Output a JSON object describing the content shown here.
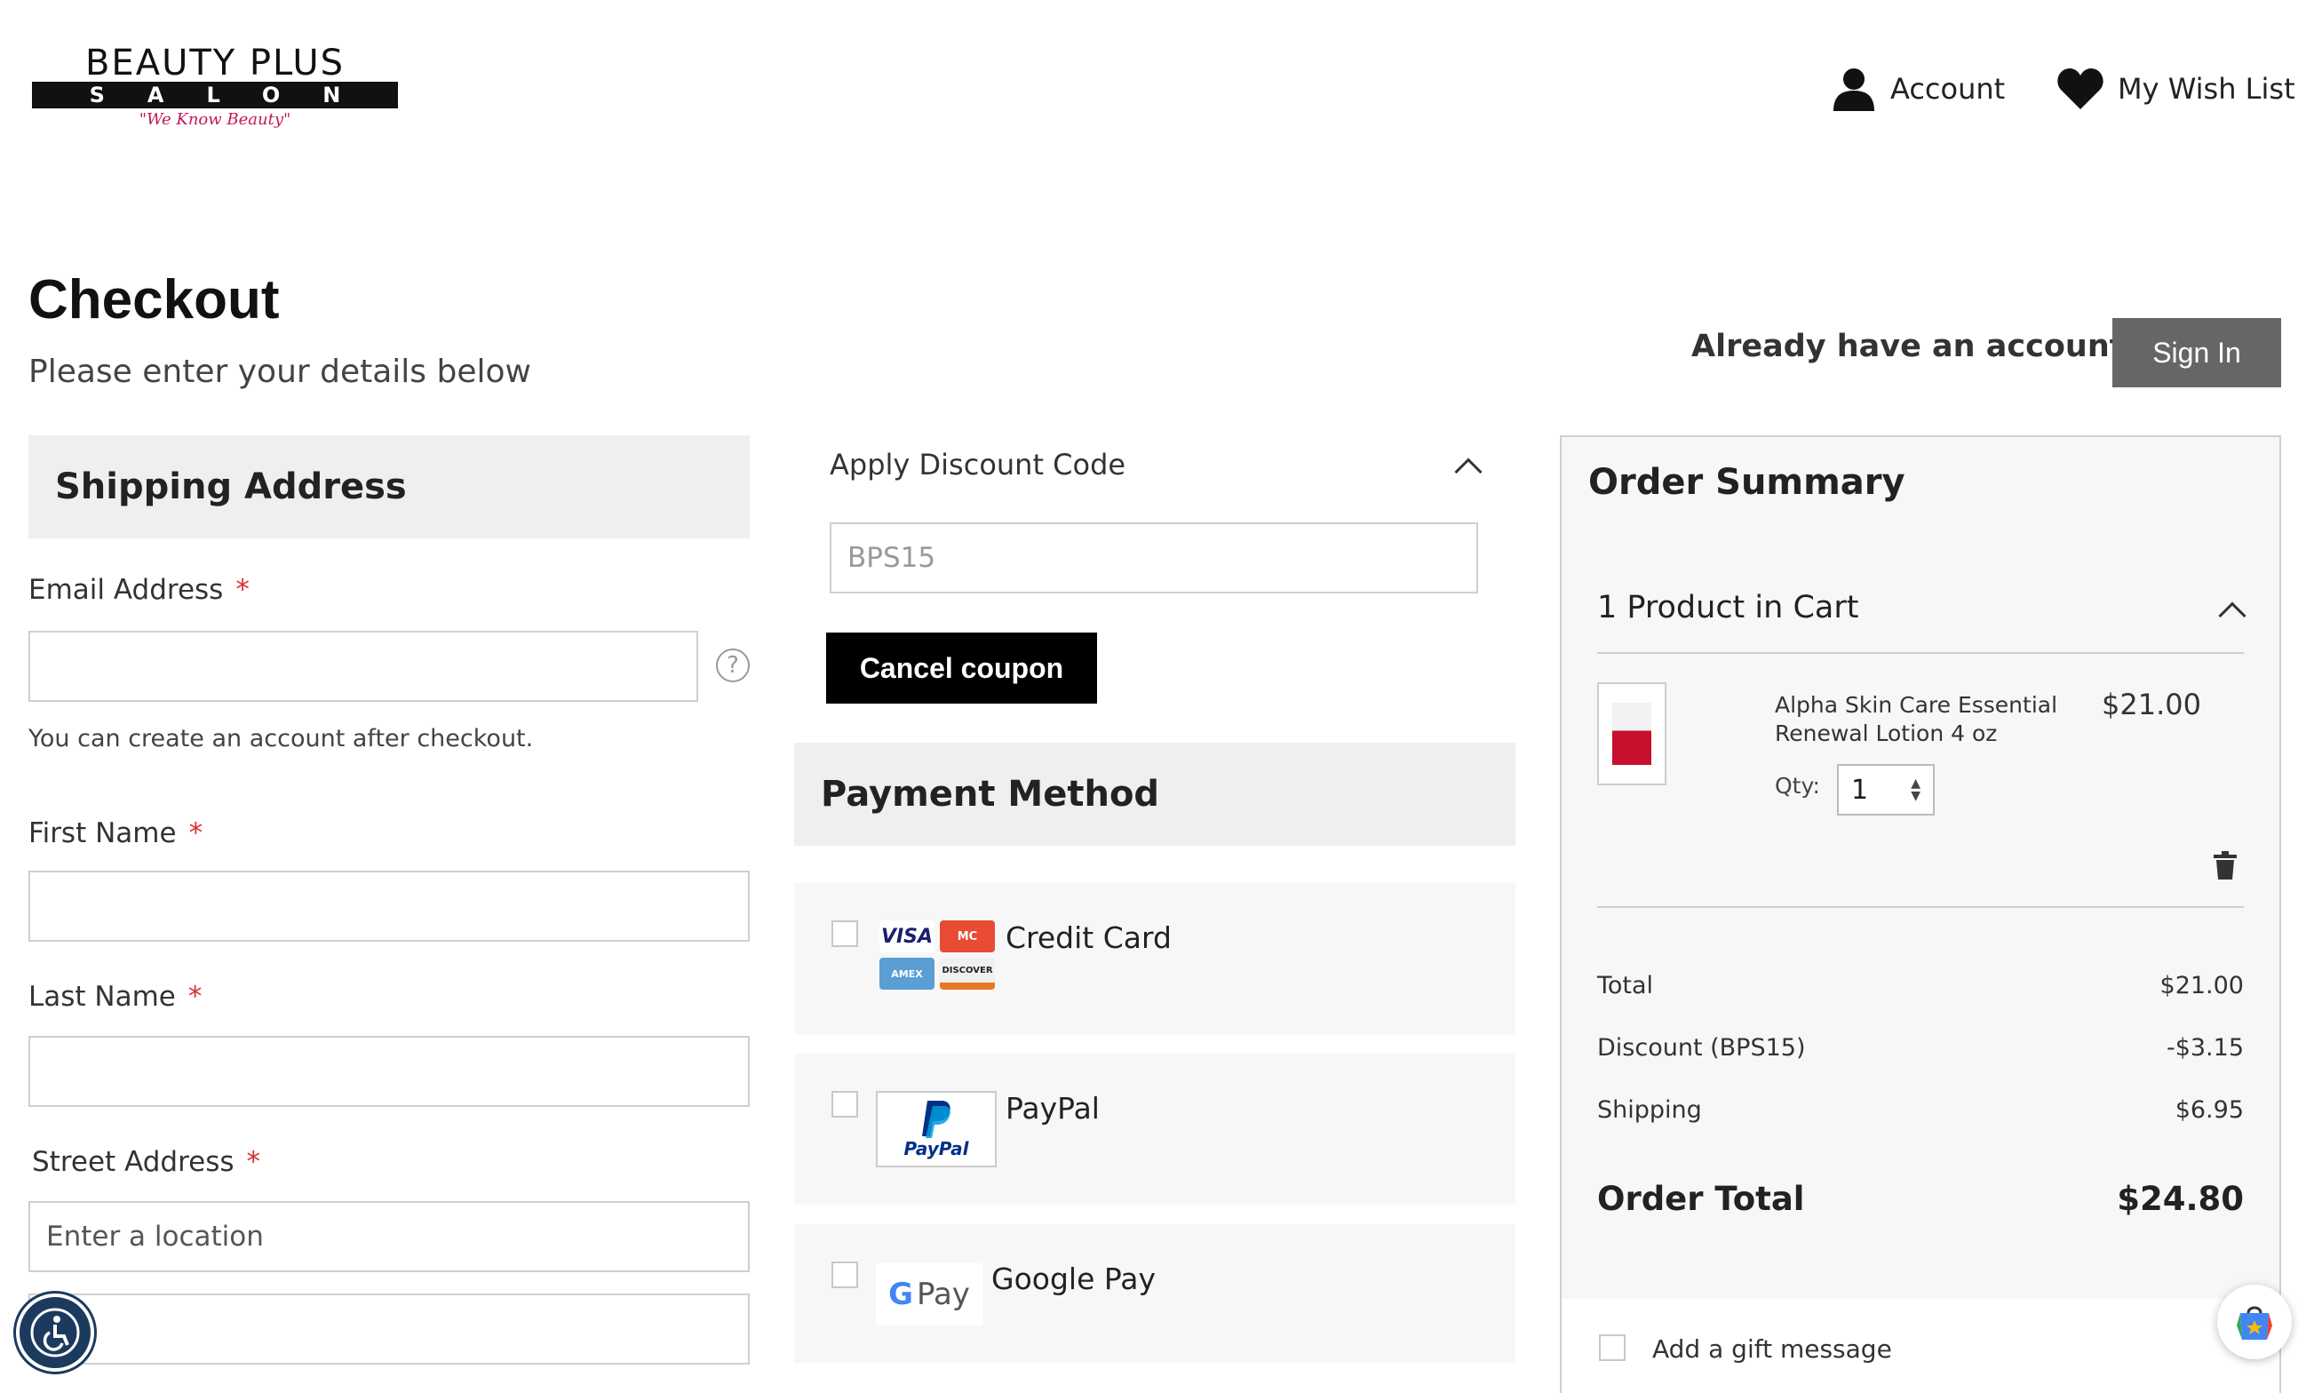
{
  "header": {
    "logo_top": "BEAUTY PLUS",
    "logo_bar": "SALON",
    "logo_tag": "\"We Know Beauty\"",
    "account_label": "Account",
    "wishlist_label": "My Wish List"
  },
  "page": {
    "title": "Checkout",
    "subtitle": "Please enter your details below",
    "already_account": "Already have an account?",
    "sign_in_label": "Sign In"
  },
  "shipping": {
    "heading": "Shipping Address",
    "email_label": "Email Address",
    "email_value": "",
    "email_note": "You can create an account after checkout.",
    "first_name_label": "First Name",
    "last_name_label": "Last Name",
    "street_label": "Street Address",
    "street_placeholder": "Enter a location",
    "required_mark": "*",
    "help_icon": "?"
  },
  "discount": {
    "title": "Apply Discount Code",
    "code_value": "BPS15",
    "cancel_label": "Cancel coupon"
  },
  "payment": {
    "heading": "Payment Method",
    "methods": [
      {
        "label": "Credit Card",
        "icon": "credit-cards-icon"
      },
      {
        "label": "PayPal",
        "icon": "paypal-icon"
      },
      {
        "label": "Google Pay",
        "icon": "google-pay-icon"
      }
    ],
    "cards": [
      "VISA",
      "MC",
      "AMEX",
      "DISCOVER"
    ],
    "paypal_logo": "PayPal",
    "gpay_g": "G",
    "gpay_text": "Pay"
  },
  "summary": {
    "title": "Order Summary",
    "cart_count": "1 Product in Cart",
    "item": {
      "name": "Alpha Skin Care Essential Renewal Lotion 4 oz",
      "price": "$21.00",
      "qty_label": "Qty:",
      "qty": "1"
    },
    "rows": [
      {
        "label": "Total",
        "value": "$21.00"
      },
      {
        "label": "Discount (BPS15)",
        "value": "-$3.15"
      },
      {
        "label": "Shipping",
        "value": "$6.95"
      }
    ],
    "order_total_label": "Order Total",
    "order_total_value": "$24.80",
    "gift_label": "Add a gift message"
  },
  "colors": {
    "accent_black": "#000000",
    "signin_gray": "#666666",
    "required_red": "#d9302c",
    "panel_gray": "#efefef"
  }
}
